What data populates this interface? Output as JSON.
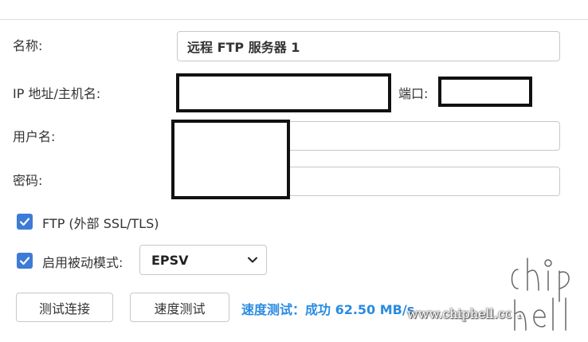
{
  "form": {
    "name_label": "名称:",
    "name_value": "远程 FTP 服务器 1",
    "host_label": "IP 地址/主机名:",
    "host_value": "",
    "port_label": "端口:",
    "port_value": "",
    "user_label": "用户名:",
    "user_value": "",
    "password_label": "密码:",
    "password_value": ""
  },
  "options": {
    "ftp_ssl_label": "FTP (外部 SSL/TLS)",
    "ftp_ssl_checked": true,
    "passive_label": "启用被动模式:",
    "passive_checked": true,
    "passive_mode_value": "EPSV"
  },
  "actions": {
    "test_connection_label": "测试连接",
    "speed_test_label": "速度测试",
    "result_text": "速度测试：成功 62.50 MB/s"
  },
  "watermark": {
    "text": "www.chiphell.com",
    "logo_text": "chip hell"
  },
  "colors": {
    "accent": "#3d7bd6",
    "status": "#2a8be0",
    "border": "#c8c8c8"
  }
}
